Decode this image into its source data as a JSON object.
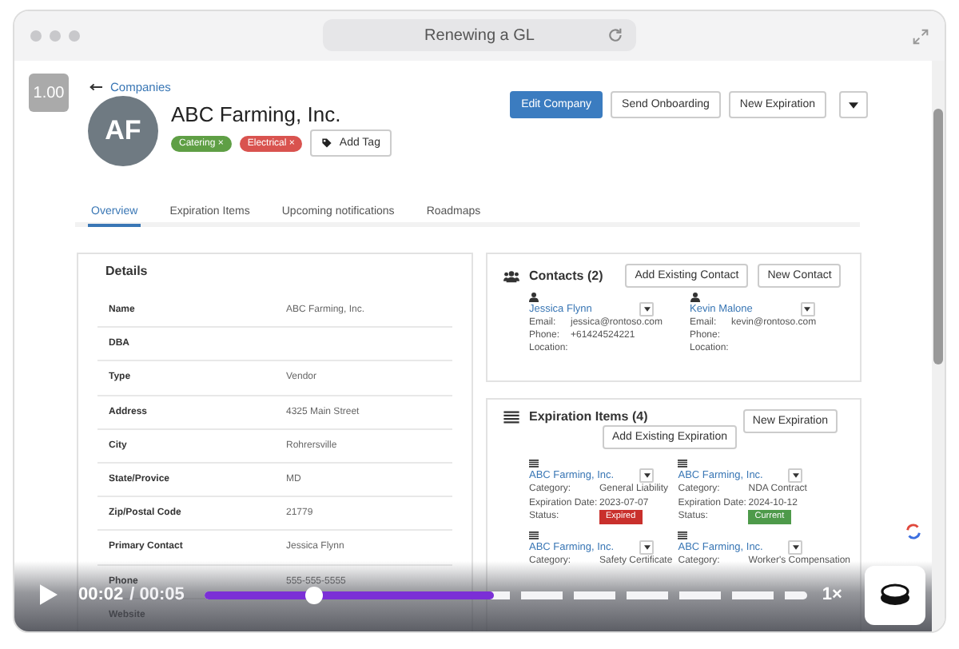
{
  "window": {
    "title": "Renewing a GL"
  },
  "version_badge": "1.00",
  "breadcrumb": {
    "link": "Companies"
  },
  "company": {
    "initials": "AF",
    "name": "ABC Farming, Inc.",
    "add_tag": "Add Tag",
    "tags": [
      {
        "label": "Catering",
        "remove": "×",
        "color": "#5f9f45"
      },
      {
        "label": "Electrical",
        "remove": "×",
        "color": "#d9534f"
      }
    ]
  },
  "actions": [
    {
      "label": "Edit Company",
      "primary": true
    },
    {
      "label": "Send Onboarding",
      "primary": false
    },
    {
      "label": "New Expiration",
      "primary": false
    }
  ],
  "tabs": [
    {
      "label": "Overview",
      "selected": true
    },
    {
      "label": "Expiration Items",
      "selected": false
    },
    {
      "label": "Upcoming notifications",
      "selected": false
    },
    {
      "label": "Roadmaps",
      "selected": false
    }
  ],
  "details": {
    "title": "Details",
    "rows": [
      {
        "label": "Name",
        "value": "ABC Farming, Inc."
      },
      {
        "label": "DBA"
      },
      {
        "label": "Type",
        "value": "Vendor"
      },
      {
        "label": "Address",
        "value": "4325 Main Street"
      },
      {
        "label": "City",
        "value": "Rohrersville"
      },
      {
        "label": "State/Provice",
        "value": "MD"
      },
      {
        "label": "Zip/Postal Code",
        "value": "21779"
      },
      {
        "label": "Primary Contact",
        "value": "Jessica Flynn"
      },
      {
        "label": "Phone",
        "value": "555-555-5555"
      },
      {
        "label": "Website"
      }
    ]
  },
  "contacts": {
    "title": "Contacts (2)",
    "buttons": [
      "Add Existing Contact",
      "New Contact"
    ],
    "items": [
      {
        "name": "Jessica Flynn",
        "fields": [
          {
            "label": "Email:",
            "value": "jessica@rontoso.com"
          },
          {
            "label": "Phone:",
            "value": "+61424524221"
          },
          {
            "label": "Location:"
          }
        ]
      },
      {
        "name": "Kevin Malone",
        "fields": [
          {
            "label": "Email:",
            "value": "kevin@rontoso.com"
          },
          {
            "label": "Phone:"
          },
          {
            "label": "Location:"
          }
        ]
      }
    ]
  },
  "expiration_items": {
    "title": "Expiration Items (4)",
    "add_button": "Add Existing Expiration",
    "new_button": "New Expiration",
    "items": [
      {
        "name": "ABC Farming, Inc.",
        "fields": [
          {
            "label": "Category:",
            "value": "General Liability"
          },
          {
            "label": "Expiration Date:",
            "value": "2023-07-07"
          }
        ],
        "status": {
          "caption": "Status:",
          "label": "Expired",
          "color": "#c9302c"
        }
      },
      {
        "name": "ABC Farming, Inc.",
        "fields": [
          {
            "label": "Category:",
            "value": "NDA Contract"
          },
          {
            "label": "Expiration Date:",
            "value": "2024-10-12"
          }
        ],
        "status": {
          "caption": "Status:",
          "label": "Current",
          "color": "#4e9a4a"
        }
      },
      {
        "name": "ABC Farming, Inc.",
        "fields": [
          {
            "label": "Category:",
            "value": "Safety Certificate"
          }
        ]
      },
      {
        "name": "ABC Farming, Inc.",
        "fields": [
          {
            "label": "Category:",
            "value": "Worker's Compensation"
          }
        ]
      }
    ]
  },
  "player": {
    "time_current": "00:02",
    "time_total": "/ 00:05",
    "buffer": {
      "level": 0.48
    },
    "progress": {
      "level": 0.18
    },
    "speed": "1×"
  }
}
